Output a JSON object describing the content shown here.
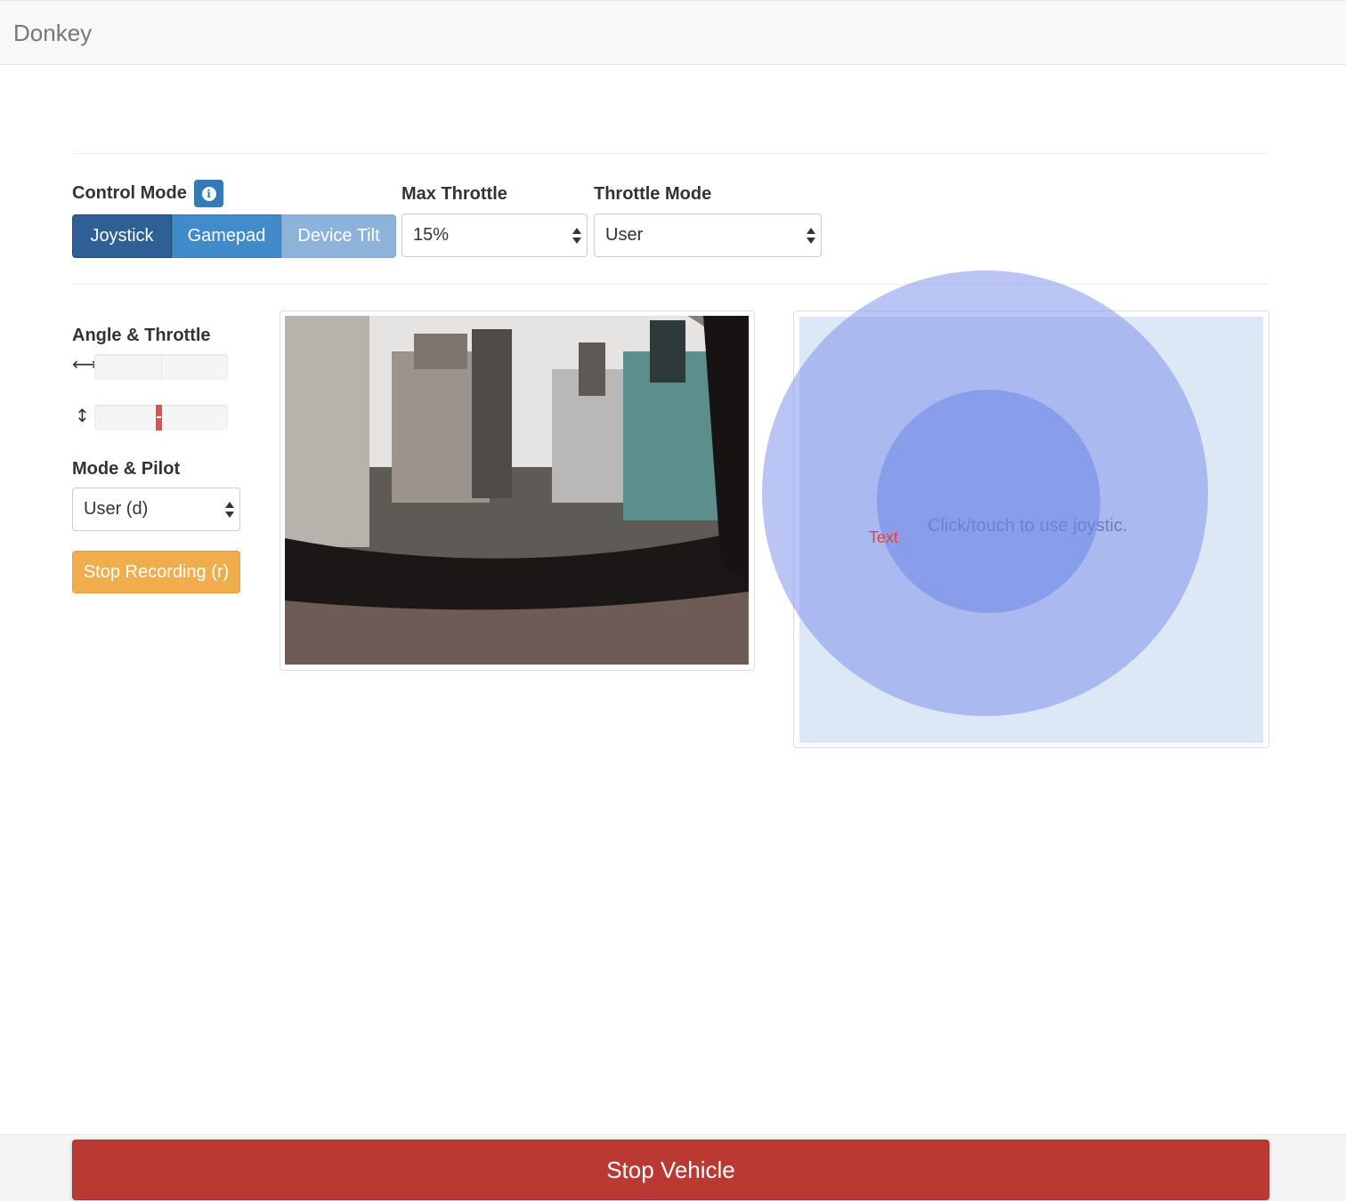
{
  "navbar": {
    "brand": "Donkey"
  },
  "controls": {
    "control_mode_label": "Control Mode",
    "control_modes": [
      "Joystick",
      "Gamepad",
      "Device Tilt"
    ],
    "active_control_mode": "Joystick",
    "max_throttle_label": "Max Throttle",
    "max_throttle_value": "15%",
    "throttle_mode_label": "Throttle Mode",
    "throttle_mode_value": "User"
  },
  "sidebar": {
    "angle_throttle_label": "Angle & Throttle",
    "angle_value": 0,
    "throttle_value": 0,
    "mode_pilot_label": "Mode & Pilot",
    "mode_pilot_value": "User (d)",
    "recording_button": "Stop Recording (r)"
  },
  "joystick": {
    "hint": "Click/touch to use joystic.",
    "debug_text": "Text"
  },
  "footer": {
    "stop_vehicle": "Stop Vehicle"
  },
  "colors": {
    "primary": "#337ab7",
    "warning": "#f0ad4e",
    "danger": "#ba3a33",
    "joystick_area": "#dce8f6"
  },
  "icons": {
    "info": "info-circle-icon",
    "angle": "horizontal-arrows-icon",
    "throttle": "vertical-arrows-icon"
  }
}
